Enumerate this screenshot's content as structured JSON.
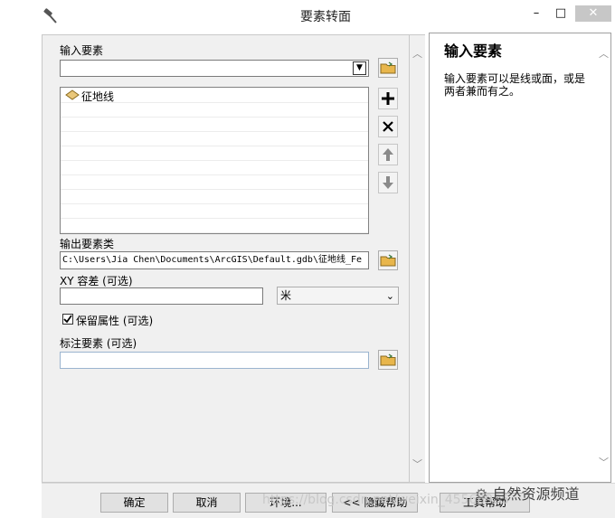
{
  "window": {
    "title": "要素转面",
    "minimize": "–",
    "maximize": "□",
    "close": "✕"
  },
  "form": {
    "input_label": "输入要素",
    "input_value": "",
    "list_items": [
      "征地线"
    ],
    "output_label": "输出要素类",
    "output_value": "C:\\Users\\Jia Chen\\Documents\\ArcGIS\\Default.gdb\\征地线_Fe",
    "xy_label": "XY 容差 (可选)",
    "xy_value": "",
    "unit_value": "米",
    "preserve_label": "保留属性 (可选)",
    "preserve_checked": true,
    "label_features_label": "标注要素 (可选)",
    "label_features_value": ""
  },
  "help": {
    "title": "输入要素",
    "body": "输入要素可以是线或面，或是两者兼而有之。"
  },
  "buttons": {
    "ok": "确定",
    "cancel": "取消",
    "env": "环境...",
    "hide_help": "<< 隐藏帮助",
    "tool_help": "工具帮助"
  },
  "watermark": {
    "url": "https://blog.csdn.net/weixin_45568985",
    "brand": "自然资源频道"
  },
  "colors": {
    "close_bg": "#c7c7c7",
    "panel_bg": "#f0f0f0",
    "folder": "#e8b64c",
    "polygon_icon": "#e9c77a"
  }
}
